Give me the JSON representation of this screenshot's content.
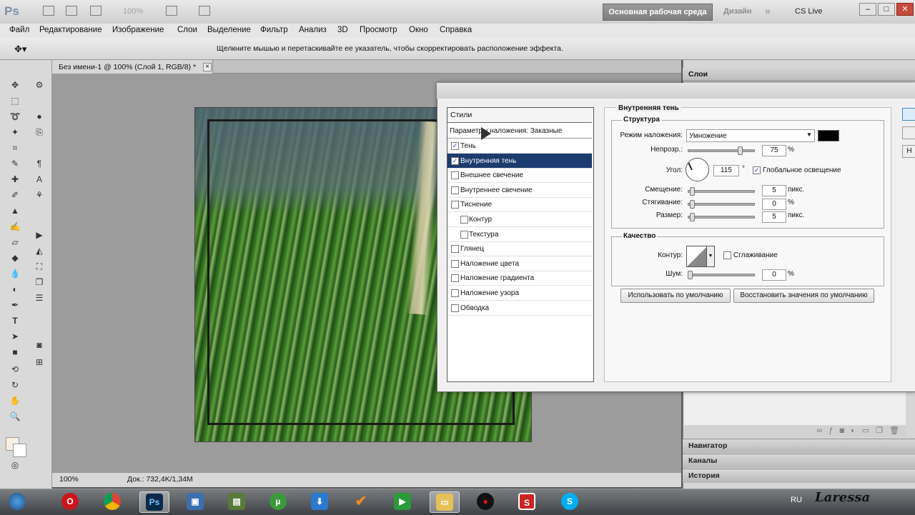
{
  "app": {
    "logo": "Ps",
    "zoom_disabled": "100%",
    "workspace_active": "Основная рабочая среда",
    "workspace_other": "Дизайн",
    "more": "»",
    "cs_live": "CS Live",
    "window_controls": [
      "–",
      "□",
      "✕"
    ]
  },
  "menu": [
    "Файл",
    "Редактирование",
    "Изображение",
    "Слои",
    "Выделение",
    "Фильтр",
    "Анализ",
    "3D",
    "Просмотр",
    "Окно",
    "Справка"
  ],
  "options_bar": {
    "tool_icon": "move-icon",
    "hint": "Щелкните мышью и перетаскивайте ее указатель, чтобы скорректировать расположение эффекта."
  },
  "document": {
    "tab_label": "Без имени-1 @ 100% (Слой 1, RGB/8) *",
    "tab_close": "×",
    "status_zoom": "100%",
    "status_doc": "Док.: 732,4K/1,34M"
  },
  "panels": {
    "layers": "Слои",
    "navigator": "Навигатор",
    "channels": "Каналы",
    "history": "История"
  },
  "dialog": {
    "styles_header": "Стили",
    "blending_options": "Параметры наложения: Заказные",
    "styles": [
      {
        "label": "Тень",
        "checked": true,
        "selected": false,
        "indent": false
      },
      {
        "label": "Внутренняя тень",
        "checked": true,
        "selected": true,
        "indent": false
      },
      {
        "label": "Внешнее свечение",
        "checked": false,
        "selected": false,
        "indent": false
      },
      {
        "label": "Внутреннее свечение",
        "checked": false,
        "selected": false,
        "indent": false
      },
      {
        "label": "Тиснение",
        "checked": false,
        "selected": false,
        "indent": false
      },
      {
        "label": "Контур",
        "checked": false,
        "selected": false,
        "indent": true
      },
      {
        "label": "Текстура",
        "checked": false,
        "selected": false,
        "indent": true
      },
      {
        "label": "Глянец",
        "checked": false,
        "selected": false,
        "indent": false
      },
      {
        "label": "Наложение цвета",
        "checked": false,
        "selected": false,
        "indent": false
      },
      {
        "label": "Наложение градиента",
        "checked": false,
        "selected": false,
        "indent": false
      },
      {
        "label": "Наложение узора",
        "checked": false,
        "selected": false,
        "indent": false
      },
      {
        "label": "Обводка",
        "checked": false,
        "selected": false,
        "indent": false
      }
    ],
    "section_title": "Внутренняя тень",
    "structure": {
      "legend": "Структура",
      "blend_mode_label": "Режим наложения:",
      "blend_mode_value": "Умножение",
      "opacity_label": "Непрозр.:",
      "opacity_value": "75",
      "opacity_unit": "%",
      "angle_label": "Угол:",
      "angle_value": "115",
      "angle_unit": "°",
      "global_light_label": "Глобальное освещение",
      "global_light_checked": true,
      "distance_label": "Смещение:",
      "distance_value": "5",
      "distance_unit": "пикс.",
      "choke_label": "Стягивание:",
      "choke_value": "0",
      "choke_unit": "%",
      "size_label": "Размер:",
      "size_value": "5",
      "size_unit": "пикс."
    },
    "quality": {
      "legend": "Качество",
      "contour_label": "Контур:",
      "antialias_label": "Сглаживание",
      "antialias_checked": false,
      "noise_label": "Шум:",
      "noise_value": "0",
      "noise_unit": "%"
    },
    "make_default": "Использовать по умолчанию",
    "reset_default": "Восстановить значения по умолчанию",
    "side_new": "Н"
  },
  "taskbar": {
    "lang": "RU",
    "watermark": "Laressa"
  },
  "colors": {
    "selection": "#1c3b6e",
    "shadow_swatch": "#000000"
  }
}
